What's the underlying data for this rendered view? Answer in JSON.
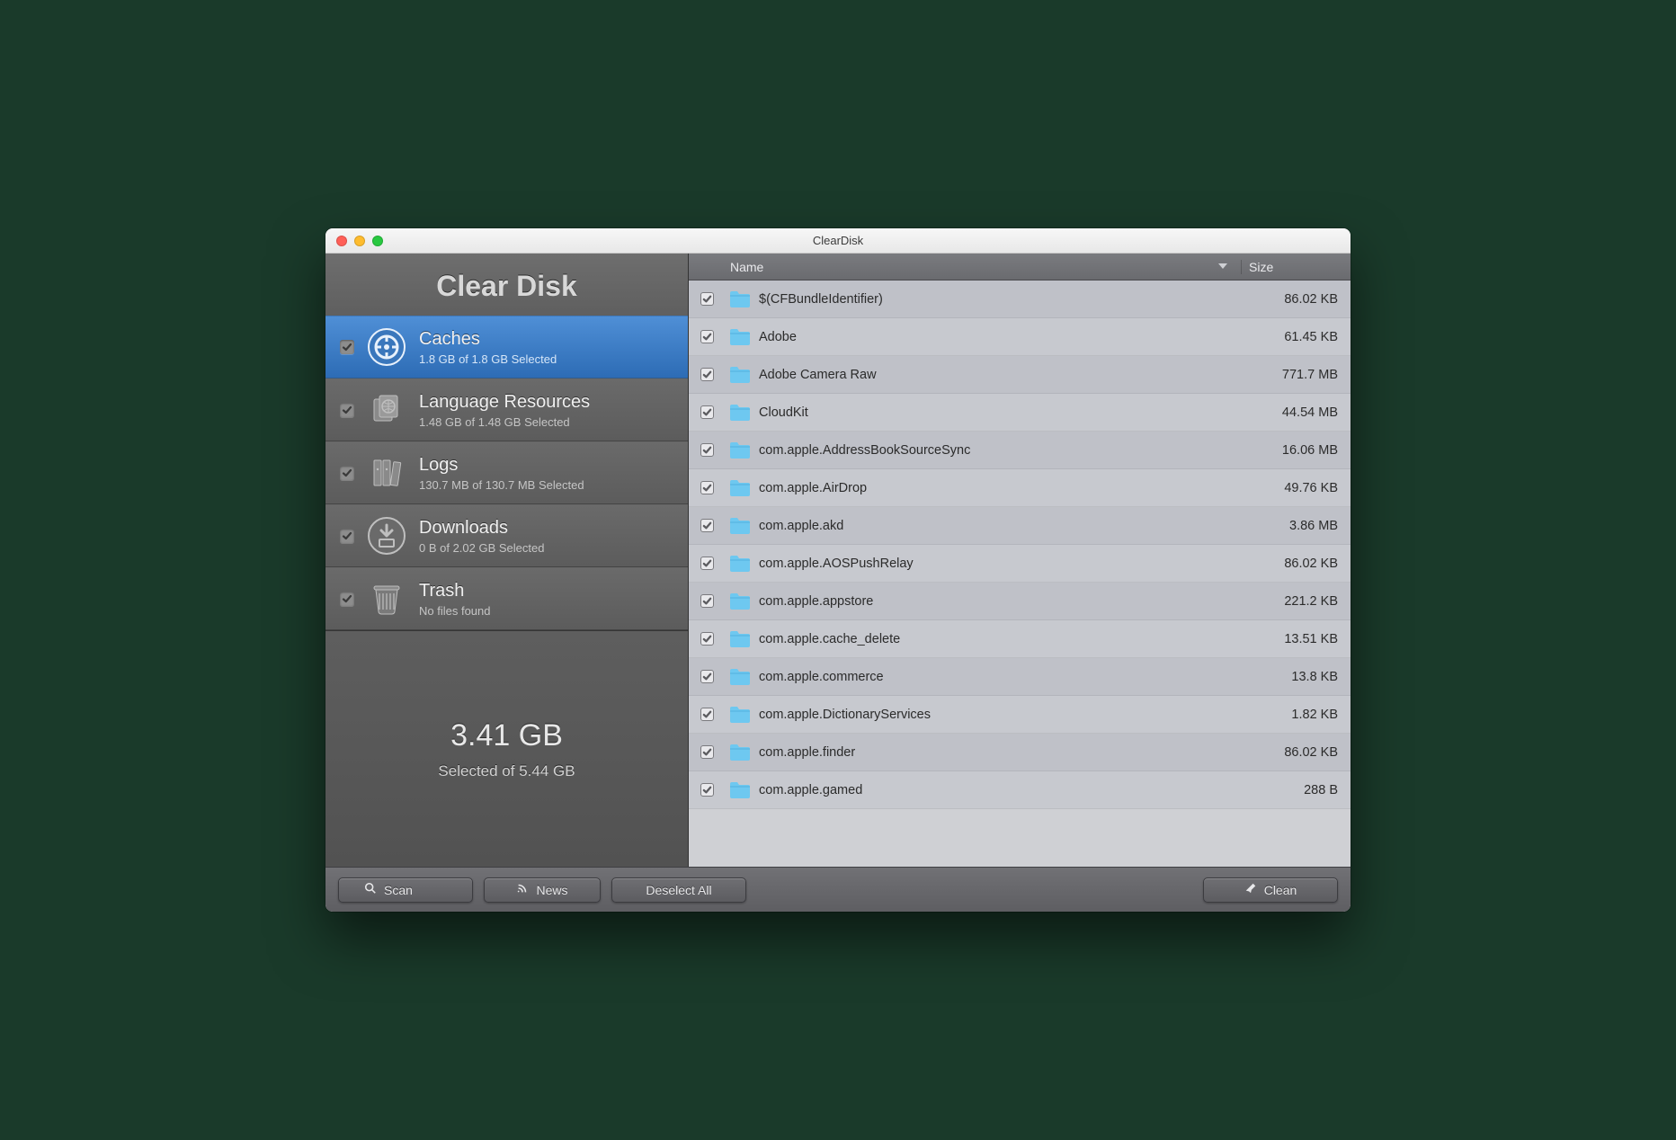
{
  "window": {
    "title": "ClearDisk"
  },
  "brand": "Clear Disk",
  "categories": [
    {
      "key": "caches",
      "label": "Caches",
      "sub": "1.8 GB of 1.8 GB Selected",
      "checked": true,
      "selected": true
    },
    {
      "key": "lang",
      "label": "Language Resources",
      "sub": "1.48 GB of 1.48 GB Selected",
      "checked": true,
      "selected": false
    },
    {
      "key": "logs",
      "label": "Logs",
      "sub": "130.7 MB of 130.7 MB Selected",
      "checked": true,
      "selected": false
    },
    {
      "key": "downloads",
      "label": "Downloads",
      "sub": "0 B of 2.02 GB Selected",
      "checked": true,
      "selected": false
    },
    {
      "key": "trash",
      "label": "Trash",
      "sub": "No files found",
      "checked": true,
      "selected": false
    }
  ],
  "summary": {
    "big": "3.41 GB",
    "small": "Selected of 5.44 GB"
  },
  "columns": {
    "name": "Name",
    "size": "Size"
  },
  "files": [
    {
      "name": "$(CFBundleIdentifier)",
      "size": "86.02 KB",
      "checked": true
    },
    {
      "name": "Adobe",
      "size": "61.45 KB",
      "checked": true
    },
    {
      "name": "Adobe Camera Raw",
      "size": "771.7 MB",
      "checked": true
    },
    {
      "name": "CloudKit",
      "size": "44.54 MB",
      "checked": true
    },
    {
      "name": "com.apple.AddressBookSourceSync",
      "size": "16.06 MB",
      "checked": true
    },
    {
      "name": "com.apple.AirDrop",
      "size": "49.76 KB",
      "checked": true
    },
    {
      "name": "com.apple.akd",
      "size": "3.86 MB",
      "checked": true
    },
    {
      "name": "com.apple.AOSPushRelay",
      "size": "86.02 KB",
      "checked": true
    },
    {
      "name": "com.apple.appstore",
      "size": "221.2 KB",
      "checked": true
    },
    {
      "name": "com.apple.cache_delete",
      "size": "13.51 KB",
      "checked": true
    },
    {
      "name": "com.apple.commerce",
      "size": "13.8 KB",
      "checked": true
    },
    {
      "name": "com.apple.DictionaryServices",
      "size": "1.82 KB",
      "checked": true
    },
    {
      "name": "com.apple.finder",
      "size": "86.02 KB",
      "checked": true
    },
    {
      "name": "com.apple.gamed",
      "size": "288 B",
      "checked": true
    }
  ],
  "footer": {
    "scan": "Scan",
    "news": "News",
    "deselect": "Deselect All",
    "clean": "Clean"
  }
}
